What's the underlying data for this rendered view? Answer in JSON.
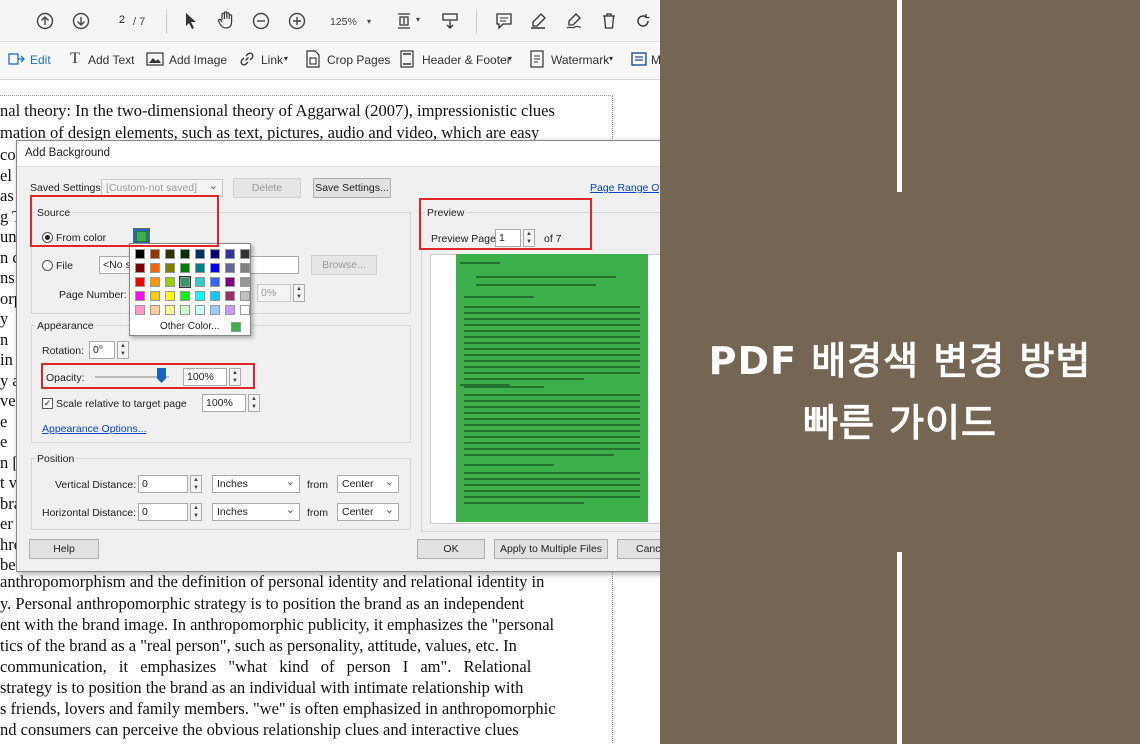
{
  "toolbar": {
    "page_current": "2",
    "page_total": "/ 7",
    "zoom": "125%",
    "edit_label": "Edit",
    "add_text_label": "Add Text",
    "add_image_label": "Add Image",
    "link_label": "Link",
    "crop_label": "Crop Pages",
    "header_footer_label": "Header & Footer",
    "watermark_label": "Watermark",
    "more_label": "M"
  },
  "document_lines_top": [
    "nal theory: In the two-dimensional theory of Aggarwal (2007), impressionistic clues",
    "mation of design elements, such as text, pictures, audio and video, which are easy"
  ],
  "document_left_fragments": [
    "co",
    "el",
    "as",
    "g T",
    "un",
    "n c",
    "ns",
    "orp",
    "y",
    "n",
    "in",
    "y a",
    "ve",
    "e",
    "e",
    "n [",
    "t v",
    "bra",
    "er",
    "hro",
    "ber"
  ],
  "document_lines_bottom": [
    "anthropomorphism and the definition of personal identity and relational identity in",
    "y. Personal anthropomorphic strategy is to position the brand as an independent",
    "ent with the brand image. In anthropomorphic publicity, it emphasizes the \"personal",
    "tics of the brand as a \"real person\", such as personality, attitude, values, etc. In",
    "communication, it emphasizes \"what kind of person I am\". Relational",
    "strategy is to position the brand as an individual with intimate relationship with",
    "s friends, lovers and family members. \"we\" is often emphasized in anthropomorphic",
    "nd consumers can perceive the obvious relationship clues and interactive clues"
  ],
  "dialog": {
    "title": "Add Background",
    "saved_settings_label": "Saved Settings:",
    "saved_settings_value": "[Custom-not saved]",
    "delete_label": "Delete",
    "save_settings_label": "Save Settings...",
    "page_range_label": "Page Range Opti",
    "source_title": "Source",
    "from_color_label": "From color",
    "file_label": "File",
    "file_value": "<No s",
    "browse_label": "Browse...",
    "page_number_label": "Page Number:",
    "scale_value": "0%",
    "other_color_label": "Other Color...",
    "appearance_title": "Appearance",
    "rotation_label": "Rotation:",
    "rotation_value": "0°",
    "opacity_label": "Opacity:",
    "opacity_value": "100%",
    "scale_relative_label": "Scale relative to target page",
    "scale_relative_value": "100%",
    "appearance_options_label": "Appearance Options...",
    "position_title": "Position",
    "vertical_label": "Vertical Distance:",
    "vertical_value": "0",
    "vertical_unit": "Inches",
    "from_label": "from",
    "vertical_from": "Center",
    "horizontal_label": "Horizontal Distance:",
    "horizontal_value": "0",
    "horizontal_unit": "Inches",
    "horizontal_from": "Center",
    "preview_title": "Preview",
    "preview_page_label": "Preview Page",
    "preview_page_value": "1",
    "preview_of": "of 7",
    "help_label": "Help",
    "ok_label": "OK",
    "apply_multiple_label": "Apply to Multiple Files",
    "cancel_label": "Cance"
  },
  "colors": {
    "selected_color": "#3fae49",
    "panel_bg": "#756553",
    "highlight": "#e0262b",
    "palette": [
      [
        "#000000",
        "#993300",
        "#333300",
        "#003300",
        "#003366",
        "#000080",
        "#333399",
        "#333333"
      ],
      [
        "#800000",
        "#ff6600",
        "#808000",
        "#008000",
        "#008080",
        "#0000ff",
        "#666699",
        "#808080"
      ],
      [
        "#ff0000",
        "#ff9900",
        "#99cc00",
        "#339966",
        "#33cccc",
        "#3366ff",
        "#800080",
        "#969696"
      ],
      [
        "#ff00ff",
        "#ffcc00",
        "#ffff00",
        "#00ff00",
        "#00ffff",
        "#00ccff",
        "#993366",
        "#c0c0c0"
      ],
      [
        "#ff99cc",
        "#ffcc99",
        "#ffff99",
        "#ccffcc",
        "#ccffff",
        "#99ccff",
        "#cc99ff",
        "#ffffff"
      ]
    ]
  },
  "headline": {
    "line1": "PDF 배경색 변경 방법",
    "line2": "빠른 가이드"
  }
}
